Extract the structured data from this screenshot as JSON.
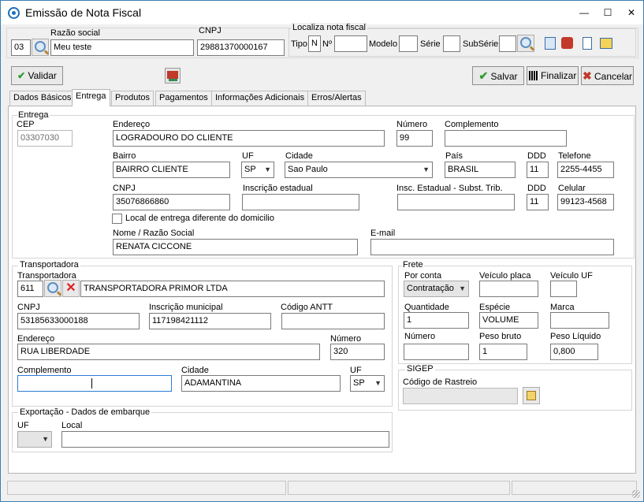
{
  "window": {
    "title": "Emissão de Nota Fiscal",
    "minimize": "—",
    "maximize": "☐",
    "close": "✕"
  },
  "top": {
    "code": "03",
    "razao_label": "Razão social",
    "razao_value": "Meu teste",
    "cnpj_label": "CNPJ",
    "cnpj_value": "29881370000167",
    "localiza_label": "Localiza nota fiscal",
    "tipo_label": "Tipo",
    "tipo_value": "N",
    "numero_label": "Nº",
    "modelo_label": "Modelo",
    "serie_label": "Série",
    "subserie_label": "SubSérie"
  },
  "toolbar": {
    "validar": "Validar",
    "salvar": "Salvar",
    "finalizar": "Finalizar",
    "cancelar": "Cancelar"
  },
  "tabs": [
    "Dados Básicos",
    "Entrega",
    "Produtos",
    "Pagamentos",
    "Informações Adicionais",
    "Erros/Alertas"
  ],
  "entrega": {
    "group_label": "Entrega",
    "cep_label": "CEP",
    "cep": "03307030",
    "endereco_label": "Endereço",
    "endereco": "LOGRADOURO DO CLIENTE",
    "numero_label": "Número",
    "numero": "99",
    "complemento_label": "Complemento",
    "complemento": "",
    "bairro_label": "Bairro",
    "bairro": "BAIRRO CLIENTE",
    "uf_label": "UF",
    "uf": "SP",
    "cidade_label": "Cidade",
    "cidade": "Sao Paulo",
    "pais_label": "País",
    "pais": "BRASIL",
    "ddd_label": "DDD",
    "ddd": "11",
    "telefone_label": "Telefone",
    "telefone": "2255-4455",
    "cnpj_label": "CNPJ",
    "cnpj": "35076866860",
    "ie_label": "Inscrição estadual",
    "ie": "",
    "ie_st_label": "Insc. Estadual - Subst. Trib.",
    "ie_st": "",
    "ddd2_label": "DDD",
    "ddd2": "11",
    "celular_label": "Celular",
    "celular": "99123-4568",
    "local_diferente_label": "Local de entrega diferente do domicilio",
    "nome_label": "Nome / Razão Social",
    "nome": "RENATA CICCONE",
    "email_label": "E-mail",
    "email": ""
  },
  "transportadora": {
    "group_label": "Transportadora",
    "label": "Transportadora",
    "codigo": "611",
    "nome": "TRANSPORTADORA PRIMOR LTDA",
    "cnpj_label": "CNPJ",
    "cnpj": "53185633000188",
    "im_label": "Inscrição municipal",
    "im": "117198421112",
    "antt_label": "Código ANTT",
    "antt": "",
    "endereco_label": "Endereço",
    "endereco": "RUA LIBERDADE",
    "numero_label": "Número",
    "numero": "320",
    "complemento_label": "Complemento",
    "complemento": "",
    "cidade_label": "Cidade",
    "cidade": "ADAMANTINA",
    "uf_label": "UF",
    "uf": "SP"
  },
  "frete": {
    "group_label": "Frete",
    "por_conta_label": "Por conta",
    "por_conta": "Contratação",
    "veiculo_placa_label": "Veículo placa",
    "veiculo_placa": "",
    "veiculo_uf_label": "Veículo UF",
    "veiculo_uf": "",
    "quantidade_label": "Quantidade",
    "quantidade": "1",
    "especie_label": "Espécie",
    "especie": "VOLUME",
    "marca_label": "Marca",
    "marca": "",
    "numero_label": "Número",
    "numero": "",
    "peso_bruto_label": "Peso bruto",
    "peso_bruto": "1",
    "peso_liquido_label": "Peso Líquido",
    "peso_liquido": "0,800"
  },
  "sigep": {
    "group_label": "SIGEP",
    "rastreio_label": "Código de Rastreio",
    "rastreio": ""
  },
  "exportacao": {
    "group_label": "Exportação - Dados de embarque",
    "uf_label": "UF",
    "uf": "",
    "local_label": "Local",
    "local": ""
  }
}
